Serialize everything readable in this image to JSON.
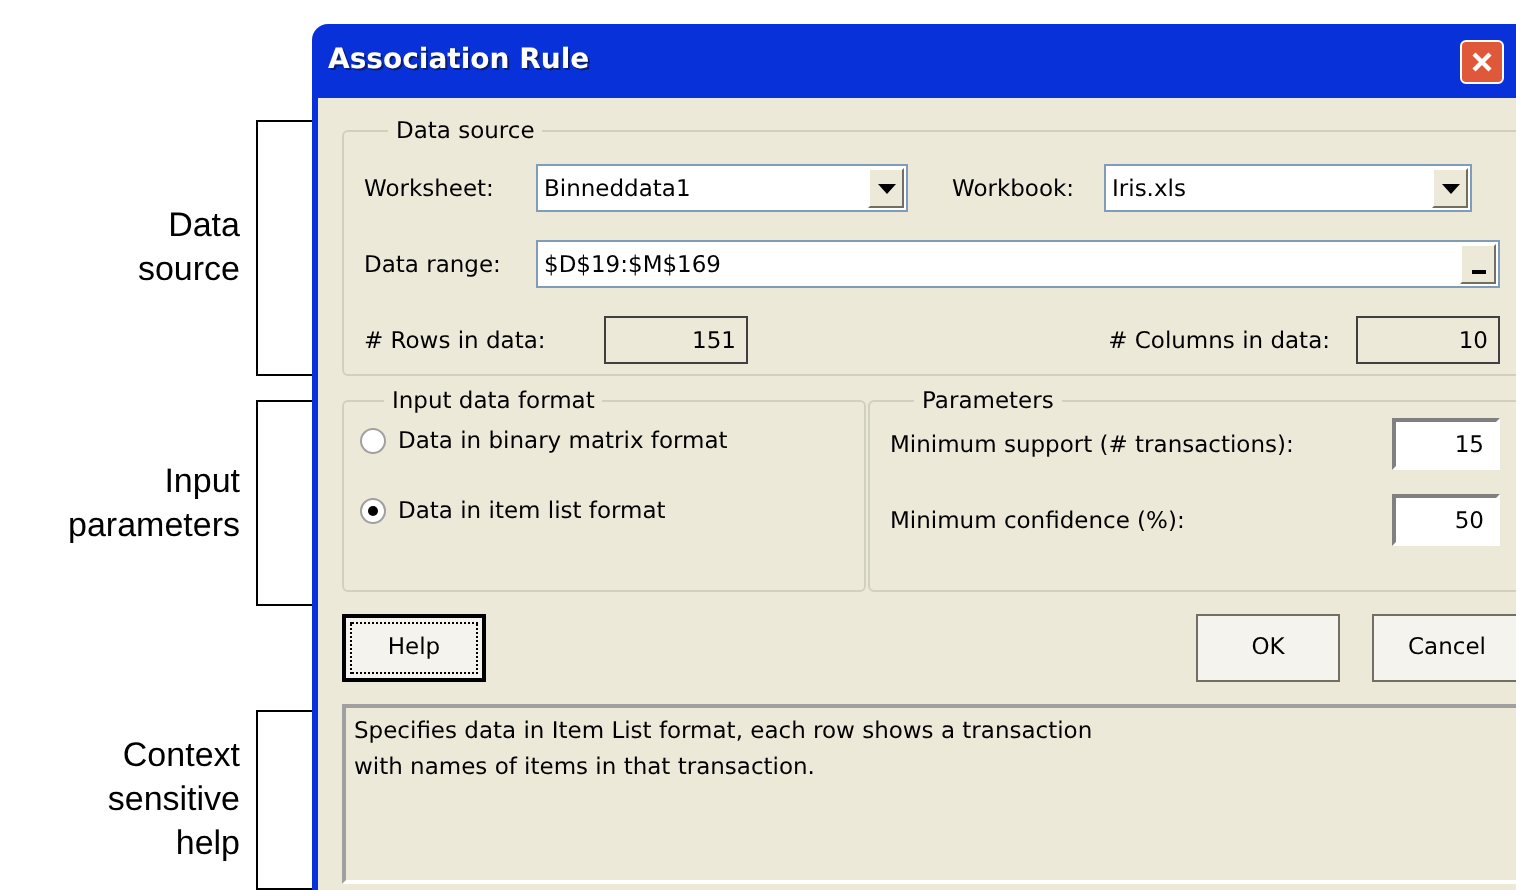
{
  "annotations": [
    {
      "label": "Data\nsource"
    },
    {
      "label": "Input\nparameters"
    },
    {
      "label": "Context\nsensitive\nhelp"
    }
  ],
  "window": {
    "title": "Association Rule"
  },
  "data_source": {
    "title": "Data source",
    "worksheet": {
      "label": "Worksheet:",
      "value": "Binneddata1"
    },
    "workbook": {
      "label": "Workbook:",
      "value": "Iris.xls"
    },
    "data_range": {
      "label": "Data range:",
      "value": "$D$19:$M$169"
    },
    "rows": {
      "label": "# Rows in data:",
      "value": "151"
    },
    "columns": {
      "label": "# Columns in data:",
      "value": "10"
    }
  },
  "input_format": {
    "title": "Input data format",
    "options": [
      {
        "label": "Data in binary matrix format",
        "selected": false
      },
      {
        "label": "Data in item list format",
        "selected": true
      }
    ]
  },
  "parameters": {
    "title": "Parameters",
    "fields": [
      {
        "label": "Minimum support (# transactions):",
        "value": "15"
      },
      {
        "label": "Minimum confidence (%):",
        "value": "50"
      }
    ]
  },
  "buttons": [
    {
      "label": "Help",
      "focused": true
    },
    {
      "label": "OK",
      "focused": false
    },
    {
      "label": "Cancel",
      "focused": false
    }
  ],
  "help_text": "Specifies data in Item List format, each row shows a transaction\nwith names of items in that transaction."
}
